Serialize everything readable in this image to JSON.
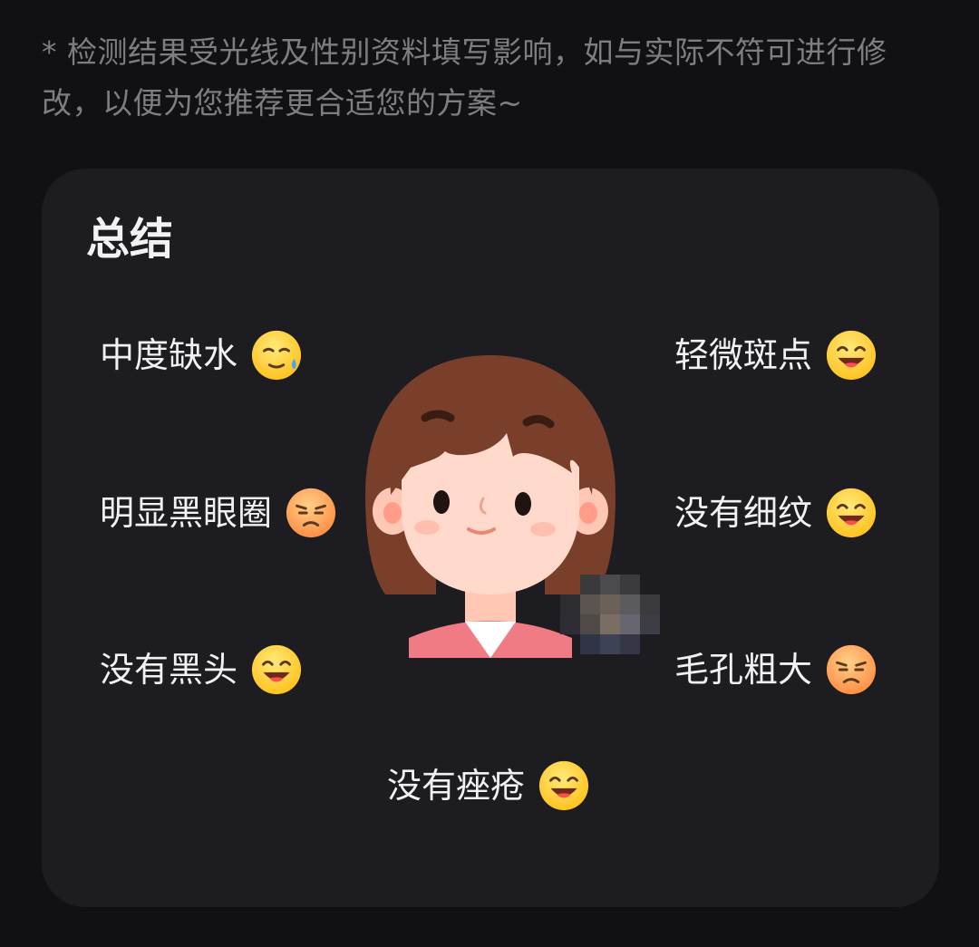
{
  "notice": {
    "text": "* 检测结果受光线及性别资料填写影响，如与实际不符可进行修改，以便为您推荐更合适您的方案~"
  },
  "summary": {
    "title": "总结",
    "items": [
      {
        "label": "中度缺水",
        "emoji": "sweat-smile-face-icon",
        "status": "neutral"
      },
      {
        "label": "轻微斑点",
        "emoji": "grinning-tongue-face-icon",
        "status": "good"
      },
      {
        "label": "明显黑眼圈",
        "emoji": "frowning-face-icon",
        "status": "bad"
      },
      {
        "label": "没有细纹",
        "emoji": "grinning-tongue-face-icon",
        "status": "good"
      },
      {
        "label": "没有黑头",
        "emoji": "grinning-tongue-face-icon",
        "status": "good"
      },
      {
        "label": "毛孔粗大",
        "emoji": "frowning-face-icon",
        "status": "bad"
      },
      {
        "label": "没有痤疮",
        "emoji": "grinning-tongue-face-icon",
        "status": "good"
      }
    ]
  },
  "colors": {
    "background": "#111114",
    "card": "#1c1c21",
    "notice_text": "#7d7d83",
    "item_text": "#f1f1f3",
    "emoji_good": "#ffd43b",
    "emoji_bad": "#ff9a52",
    "hair": "#7a3f2b",
    "skin": "#ffd9cc"
  }
}
